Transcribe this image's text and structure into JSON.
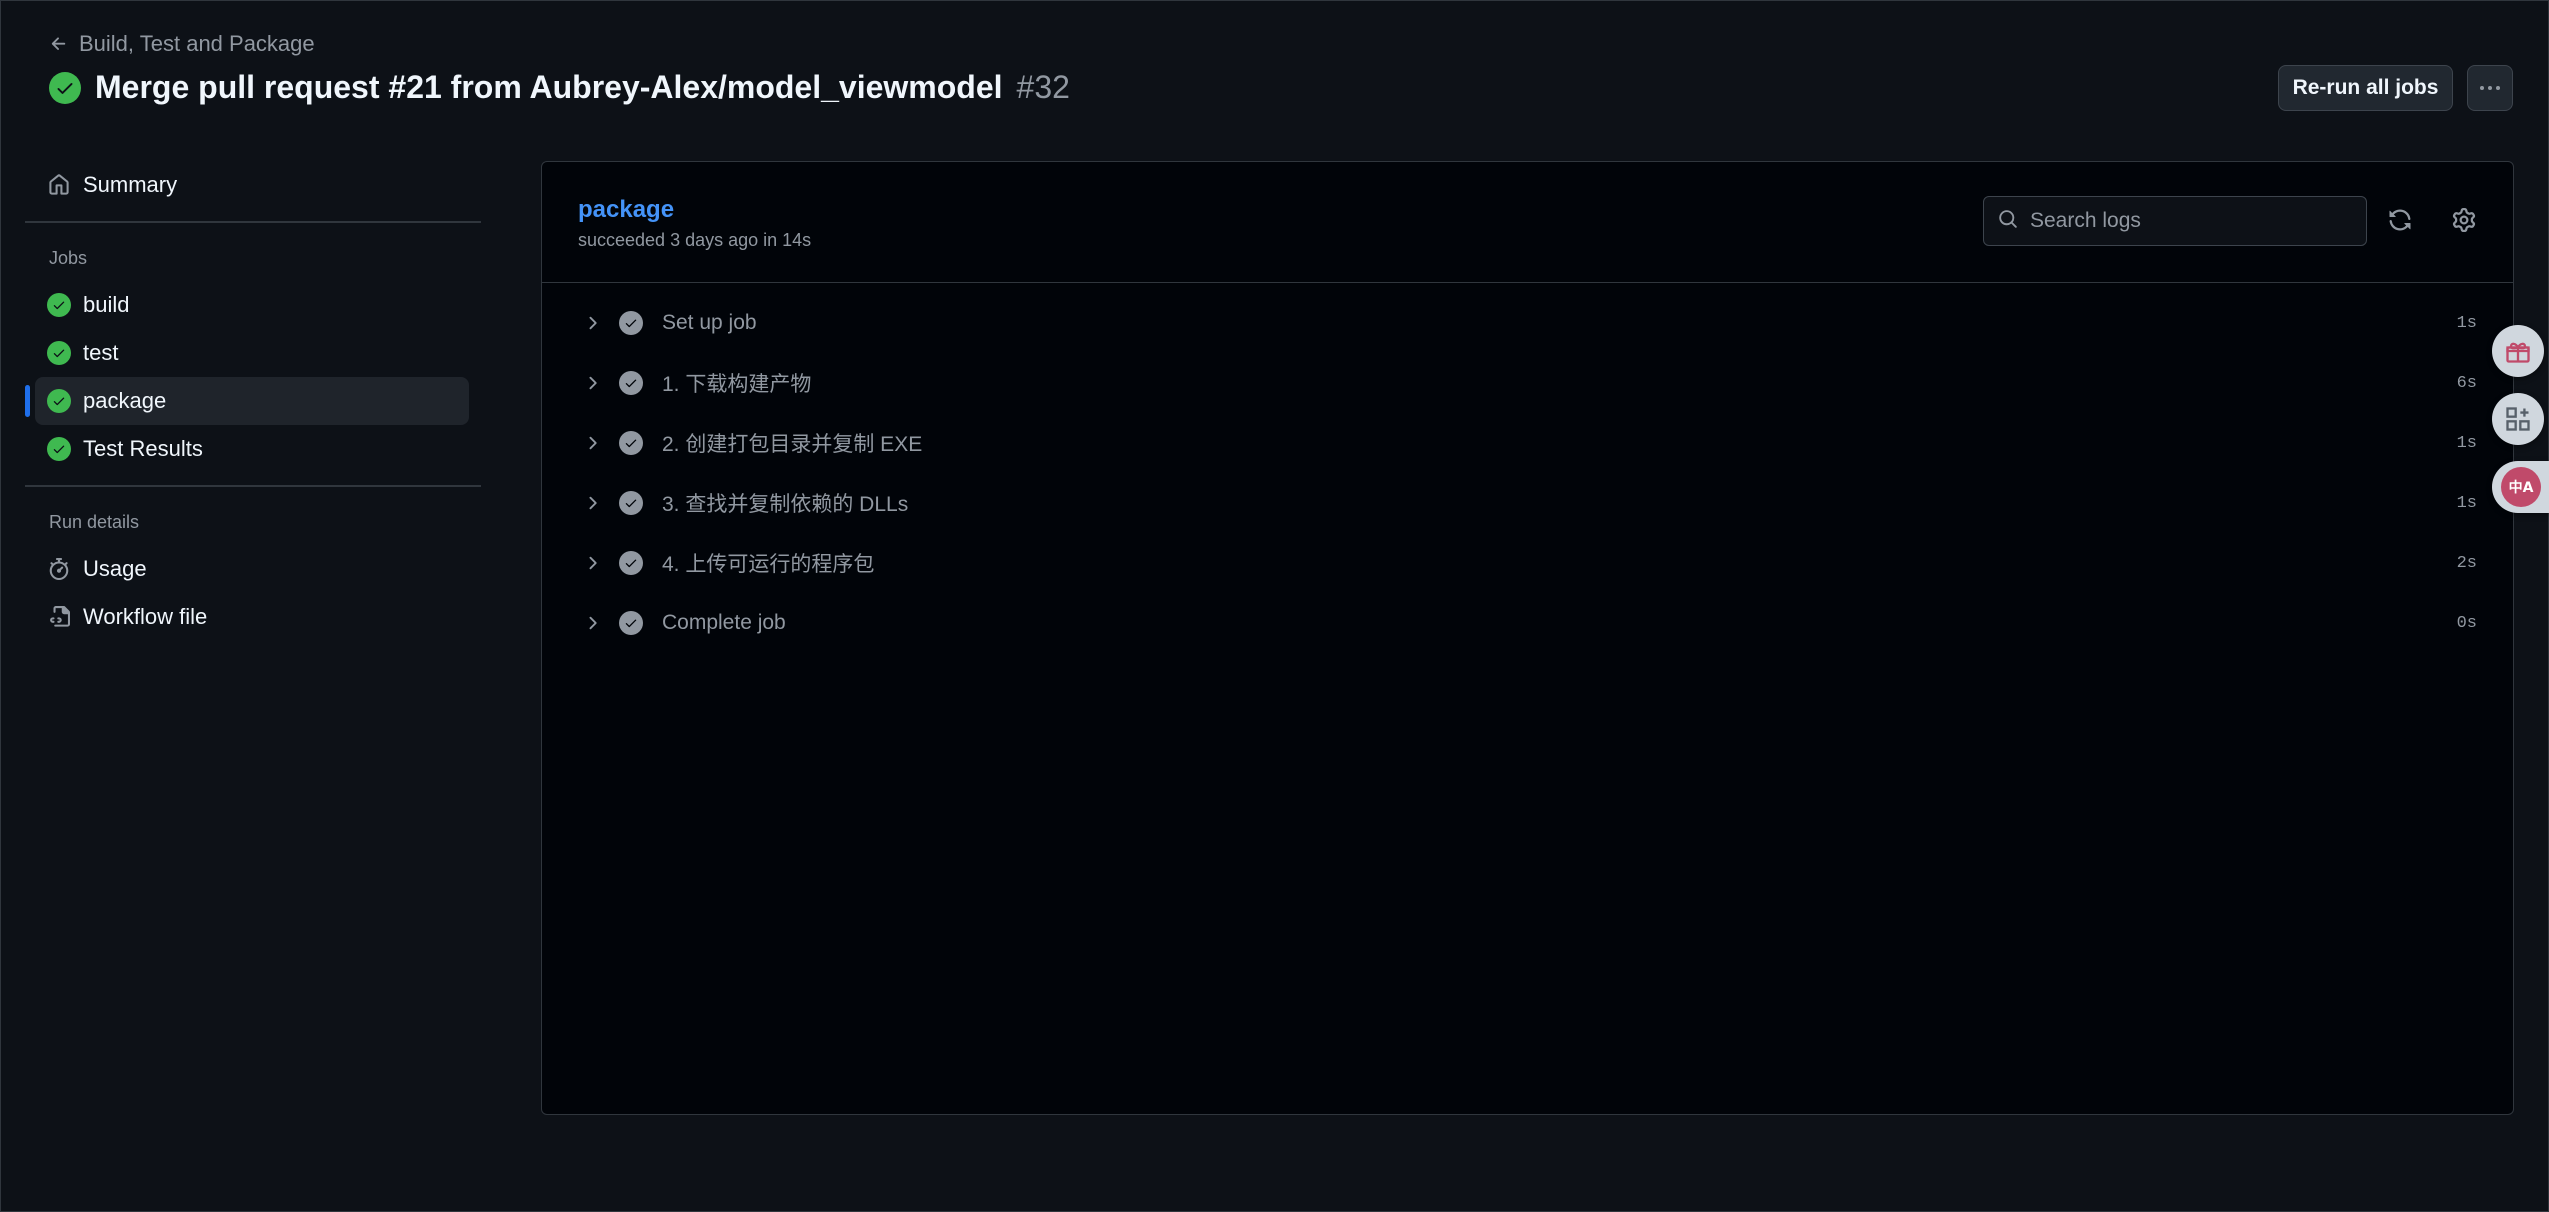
{
  "header": {
    "back_label": "Build, Test and Package",
    "title": "Merge pull request #21 from Aubrey-Alex/model_viewmodel",
    "run_number": "#32",
    "rerun_label": "Re-run all jobs"
  },
  "sidebar": {
    "summary_label": "Summary",
    "jobs_heading": "Jobs",
    "jobs": [
      {
        "label": "build",
        "status": "success"
      },
      {
        "label": "test",
        "status": "success"
      },
      {
        "label": "package",
        "status": "success",
        "active": true
      },
      {
        "label": "Test Results",
        "status": "success"
      }
    ],
    "run_details_heading": "Run details",
    "usage_label": "Usage",
    "workflow_label": "Workflow file"
  },
  "job": {
    "name": "package",
    "status_text": "succeeded 3 days ago in 14s",
    "search_placeholder": "Search logs",
    "steps": [
      {
        "label": "Set up job",
        "duration": "1s"
      },
      {
        "label": "1. 下载构建产物",
        "duration": "6s"
      },
      {
        "label": "2. 创建打包目录并复制 EXE",
        "duration": "1s"
      },
      {
        "label": "3. 查找并复制依赖的 DLLs",
        "duration": "1s"
      },
      {
        "label": "4. 上传可运行的程序包",
        "duration": "2s"
      },
      {
        "label": "Complete job",
        "duration": "0s"
      }
    ]
  },
  "floating": {
    "translate_glyph": "中A"
  },
  "colors": {
    "background": "#0d1117",
    "panel": "#010409",
    "success": "#3fb950",
    "link": "#4493f8",
    "accent_bar": "#1f6feb",
    "muted": "#9198a1"
  },
  "icons": {
    "back": "arrow-left-icon",
    "status": "check-circle-icon",
    "summary": "home-icon",
    "usage": "stopwatch-icon",
    "workflow": "workflow-file-icon",
    "search": "search-icon",
    "refresh": "refresh-icon",
    "settings": "gear-icon",
    "step_expand": "chevron-right-icon",
    "gift": "gift-icon",
    "apps": "apps-icon",
    "translate": "translate-icon"
  }
}
